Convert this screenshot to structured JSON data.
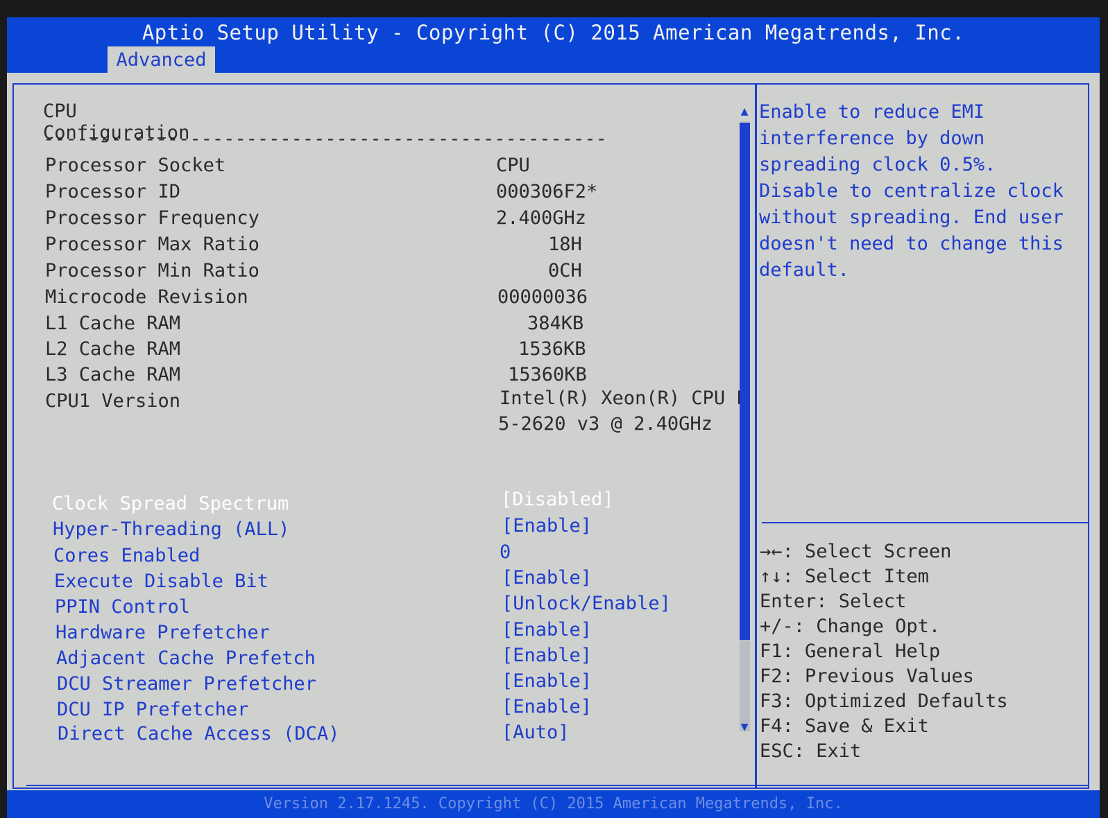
{
  "header": {
    "title": "Aptio Setup Utility - Copyright (C) 2015 American Megatrends, Inc.",
    "active_tab": "Advanced"
  },
  "section_title": "CPU Configuration",
  "separator": "--------------------------------------------------",
  "info_rows": [
    {
      "label": "Processor Socket",
      "value": "CPU"
    },
    {
      "label": "Processor ID",
      "value": "000306F2*"
    },
    {
      "label": "Processor Frequency",
      "value": "2.400GHz"
    },
    {
      "label": "Processor Max Ratio",
      "value": "18H"
    },
    {
      "label": "Processor Min Ratio",
      "value": "0CH"
    },
    {
      "label": "Microcode Revision",
      "value": "00000036"
    },
    {
      "label": "L1 Cache RAM",
      "value": "384KB"
    },
    {
      "label": "L2 Cache RAM",
      "value": "1536KB"
    },
    {
      "label": "L3 Cache RAM",
      "value": "15360KB"
    },
    {
      "label": "CPU1 Version",
      "value": "Intel(R) Xeon(R) CPU E",
      "value2": "5-2620 v3 @ 2.40GHz"
    }
  ],
  "options": [
    {
      "label": "Clock Spread Spectrum",
      "value": "[Disabled]",
      "selected": true
    },
    {
      "label": "Hyper-Threading (ALL)",
      "value": "[Enable]"
    },
    {
      "label": "Cores Enabled",
      "value": "0"
    },
    {
      "label": "Execute Disable Bit",
      "value": "[Enable]"
    },
    {
      "label": "PPIN Control",
      "value": "[Unlock/Enable]"
    },
    {
      "label": "Hardware Prefetcher",
      "value": "[Enable]"
    },
    {
      "label": "Adjacent Cache Prefetch",
      "value": "[Enable]"
    },
    {
      "label": "DCU Streamer Prefetcher",
      "value": "[Enable]"
    },
    {
      "label": "DCU IP Prefetcher",
      "value": "[Enable]"
    },
    {
      "label": "Direct Cache Access (DCA)",
      "value": "[Auto]"
    }
  ],
  "help": {
    "lines": [
      "Enable to reduce EMI",
      "interference by down",
      "spreading clock 0.5%.",
      "Disable to centralize clock",
      "without spreading. End user",
      "doesn't need to change this",
      "default."
    ]
  },
  "keys": [
    "→←: Select Screen",
    "↑↓: Select Item",
    "Enter: Select",
    "+/-: Change Opt.",
    "F1: General Help",
    "F2: Previous Values",
    "F3: Optimized Defaults",
    "F4: Save & Exit",
    "ESC: Exit"
  ],
  "footer": "Version 2.17.1245. Copyright (C) 2015 American Megatrends, Inc.",
  "icons": {
    "scroll_up": "▲",
    "scroll_down": "▼"
  },
  "colors": {
    "title_bar": "#0b45d6",
    "background": "#cfd1cf",
    "option_text": "#1f3ccc",
    "selected_text": "#ffffff"
  }
}
